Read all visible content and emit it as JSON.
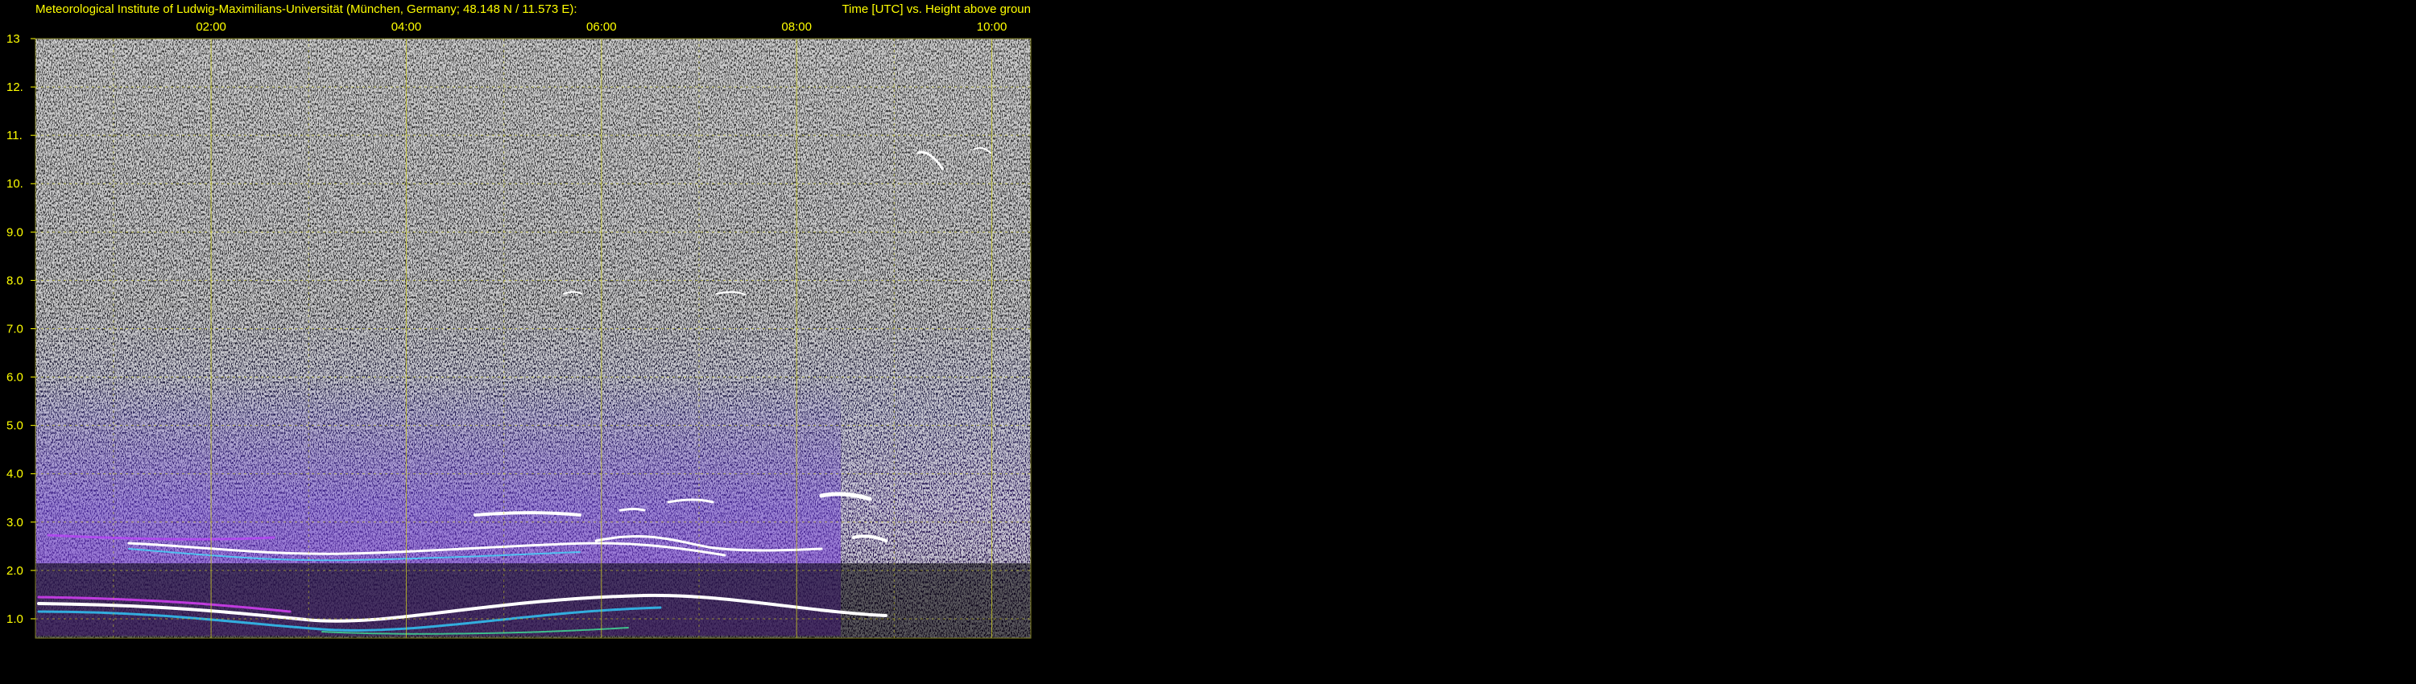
{
  "chart_data": {
    "type": "heatmap",
    "title_left": "Meteorological Institute of Ludwig-Maximilians-Universität (München, Germany; 48.148 N / 11.573 E):",
    "title_right": "Time [UTC] vs. Height above groun",
    "x_ticks": [
      "02:00",
      "04:00",
      "06:00",
      "08:00",
      "10:00"
    ],
    "y_ticks": [
      "1.0",
      "2.0",
      "3.0",
      "4.0",
      "5.0",
      "6.0",
      "7.0",
      "8.0",
      "9.0",
      "10.",
      "11.",
      "12.",
      "13"
    ],
    "x_range_hours": [
      0.2,
      10.4
    ],
    "y_range_km": [
      0.6,
      13
    ],
    "grid": true,
    "colors": {
      "text": "#ffff00",
      "grid": "#c8c820",
      "background": "#000000"
    }
  }
}
